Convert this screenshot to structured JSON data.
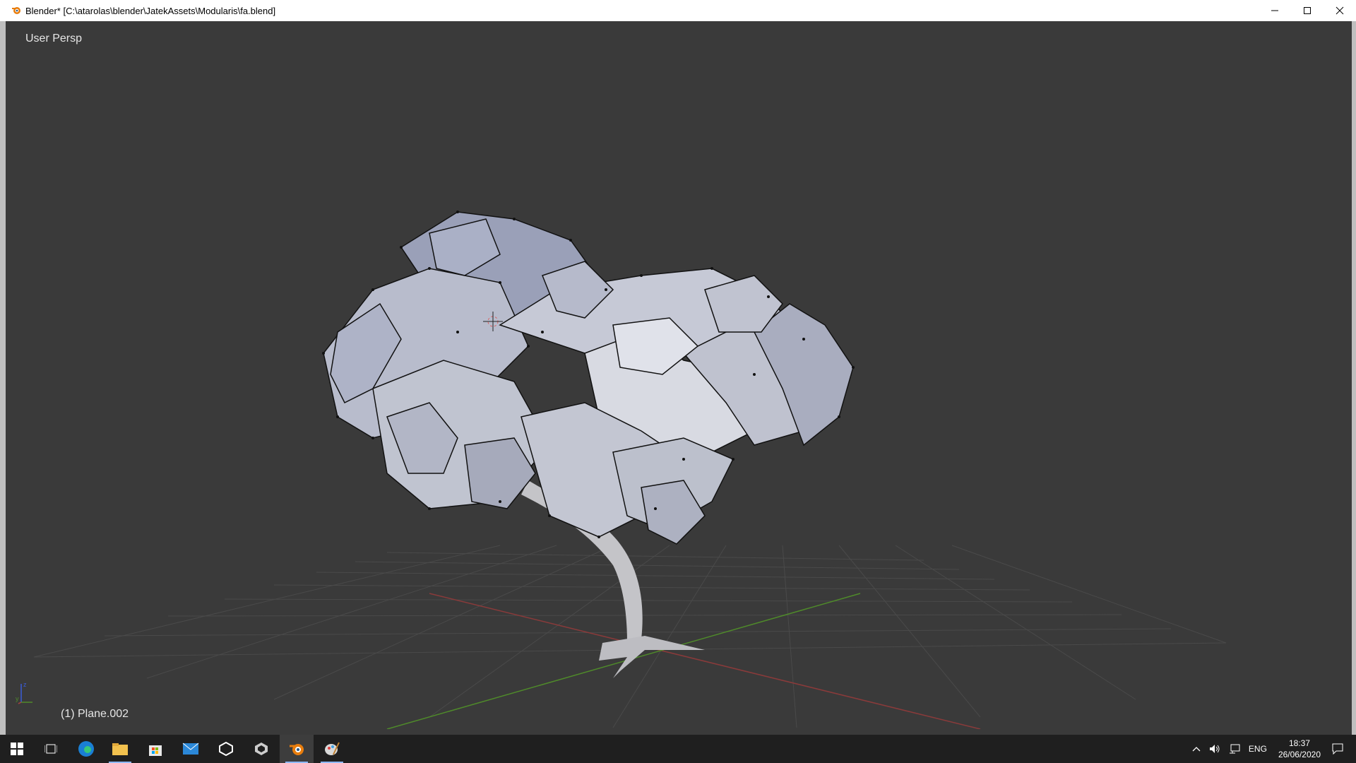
{
  "window": {
    "title": "Blender* [C:\\atarolas\\blender\\JatekAssets\\Modularis\\fa.blend]",
    "minimize_icon": "minimize-icon",
    "maximize_icon": "maximize-icon",
    "close_icon": "close-icon"
  },
  "viewport": {
    "view_name": "User Persp",
    "active_object": "(1) Plane.002",
    "colors": {
      "background": "#3a3a3a",
      "grid": "#4a4a4a",
      "x_axis": "#8a3a3a",
      "y_axis": "#4f8a2a",
      "mesh": "#c8ccd8",
      "trunk": "#c4c4c8"
    }
  },
  "taskbar": {
    "icons": [
      "windows-start-icon",
      "task-view-icon",
      "edge-browser-icon",
      "file-explorer-icon",
      "store-icon",
      "mail-icon",
      "unity-icon",
      "unity-hub-icon",
      "blender-icon",
      "paint-icon"
    ],
    "tray": {
      "language": "ENG",
      "time": "18:37",
      "date": "26/06/2020"
    }
  }
}
